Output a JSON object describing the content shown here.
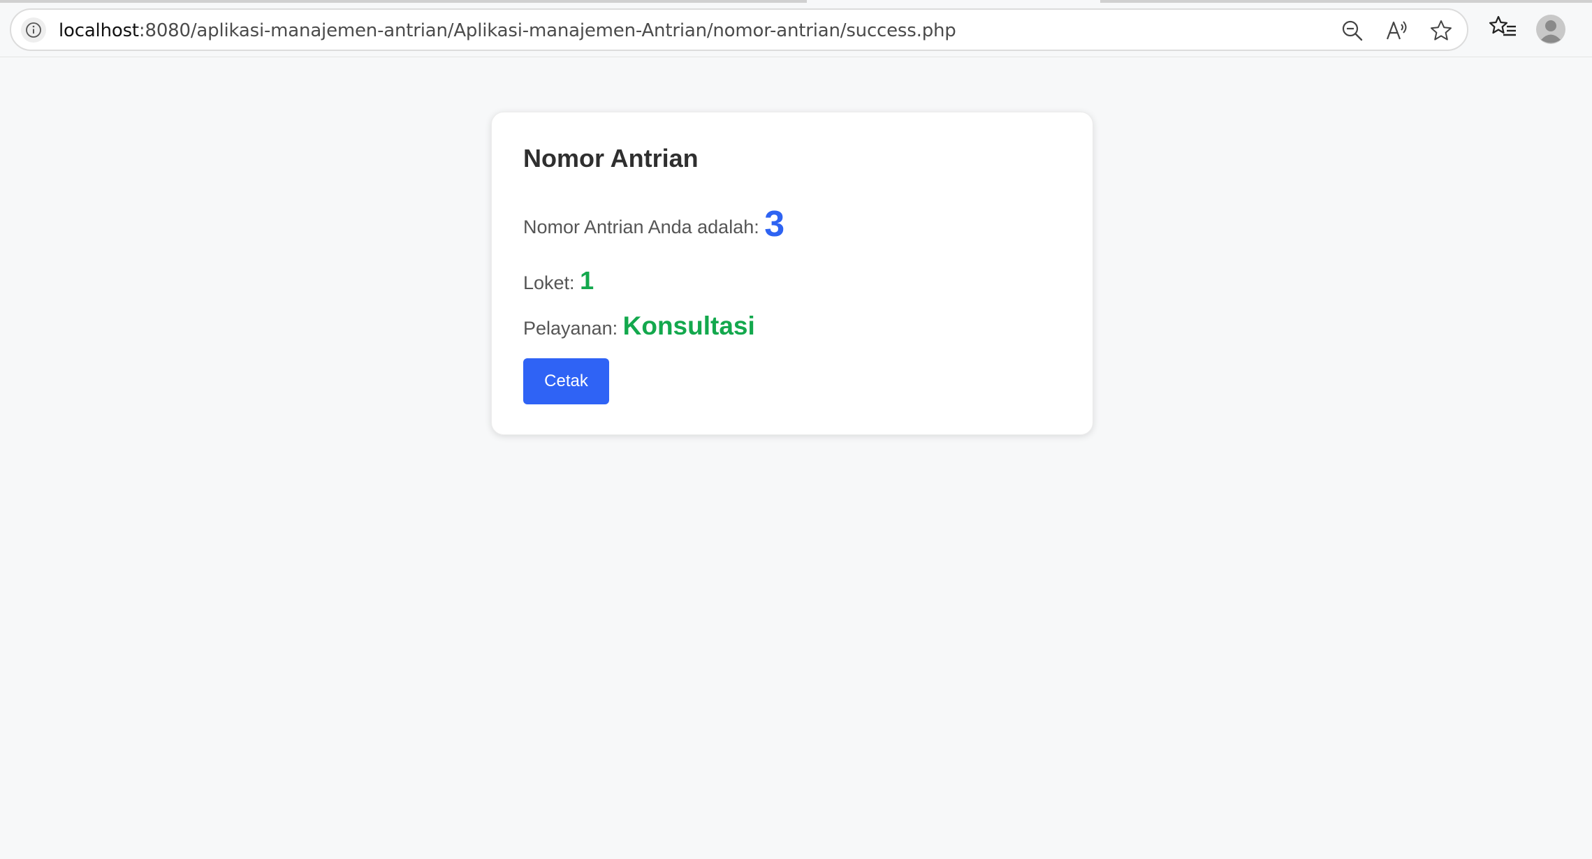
{
  "browser": {
    "url_host": "localhost",
    "url_rest": ":8080/aplikasi-manajemen-antrian/Aplikasi-manajemen-Antrian/nomor-antrian/success.php",
    "icons": [
      "info-icon",
      "zoom-out-icon",
      "read-aloud-icon",
      "favorite-star-icon",
      "favorites-list-icon",
      "profile-avatar-icon"
    ]
  },
  "card": {
    "title": "Nomor Antrian",
    "queue_label": "Nomor Antrian Anda adalah:",
    "queue_number": "3",
    "loket_label": "Loket:",
    "loket_value": "1",
    "service_label": "Pelayanan:",
    "service_value": "Konsultasi",
    "print_button_label": "Cetak"
  },
  "colors": {
    "page_background": "#f7f8f9",
    "queue_number": "#2e63f2",
    "green_value": "#13a84d",
    "button": "#2f63f5"
  }
}
